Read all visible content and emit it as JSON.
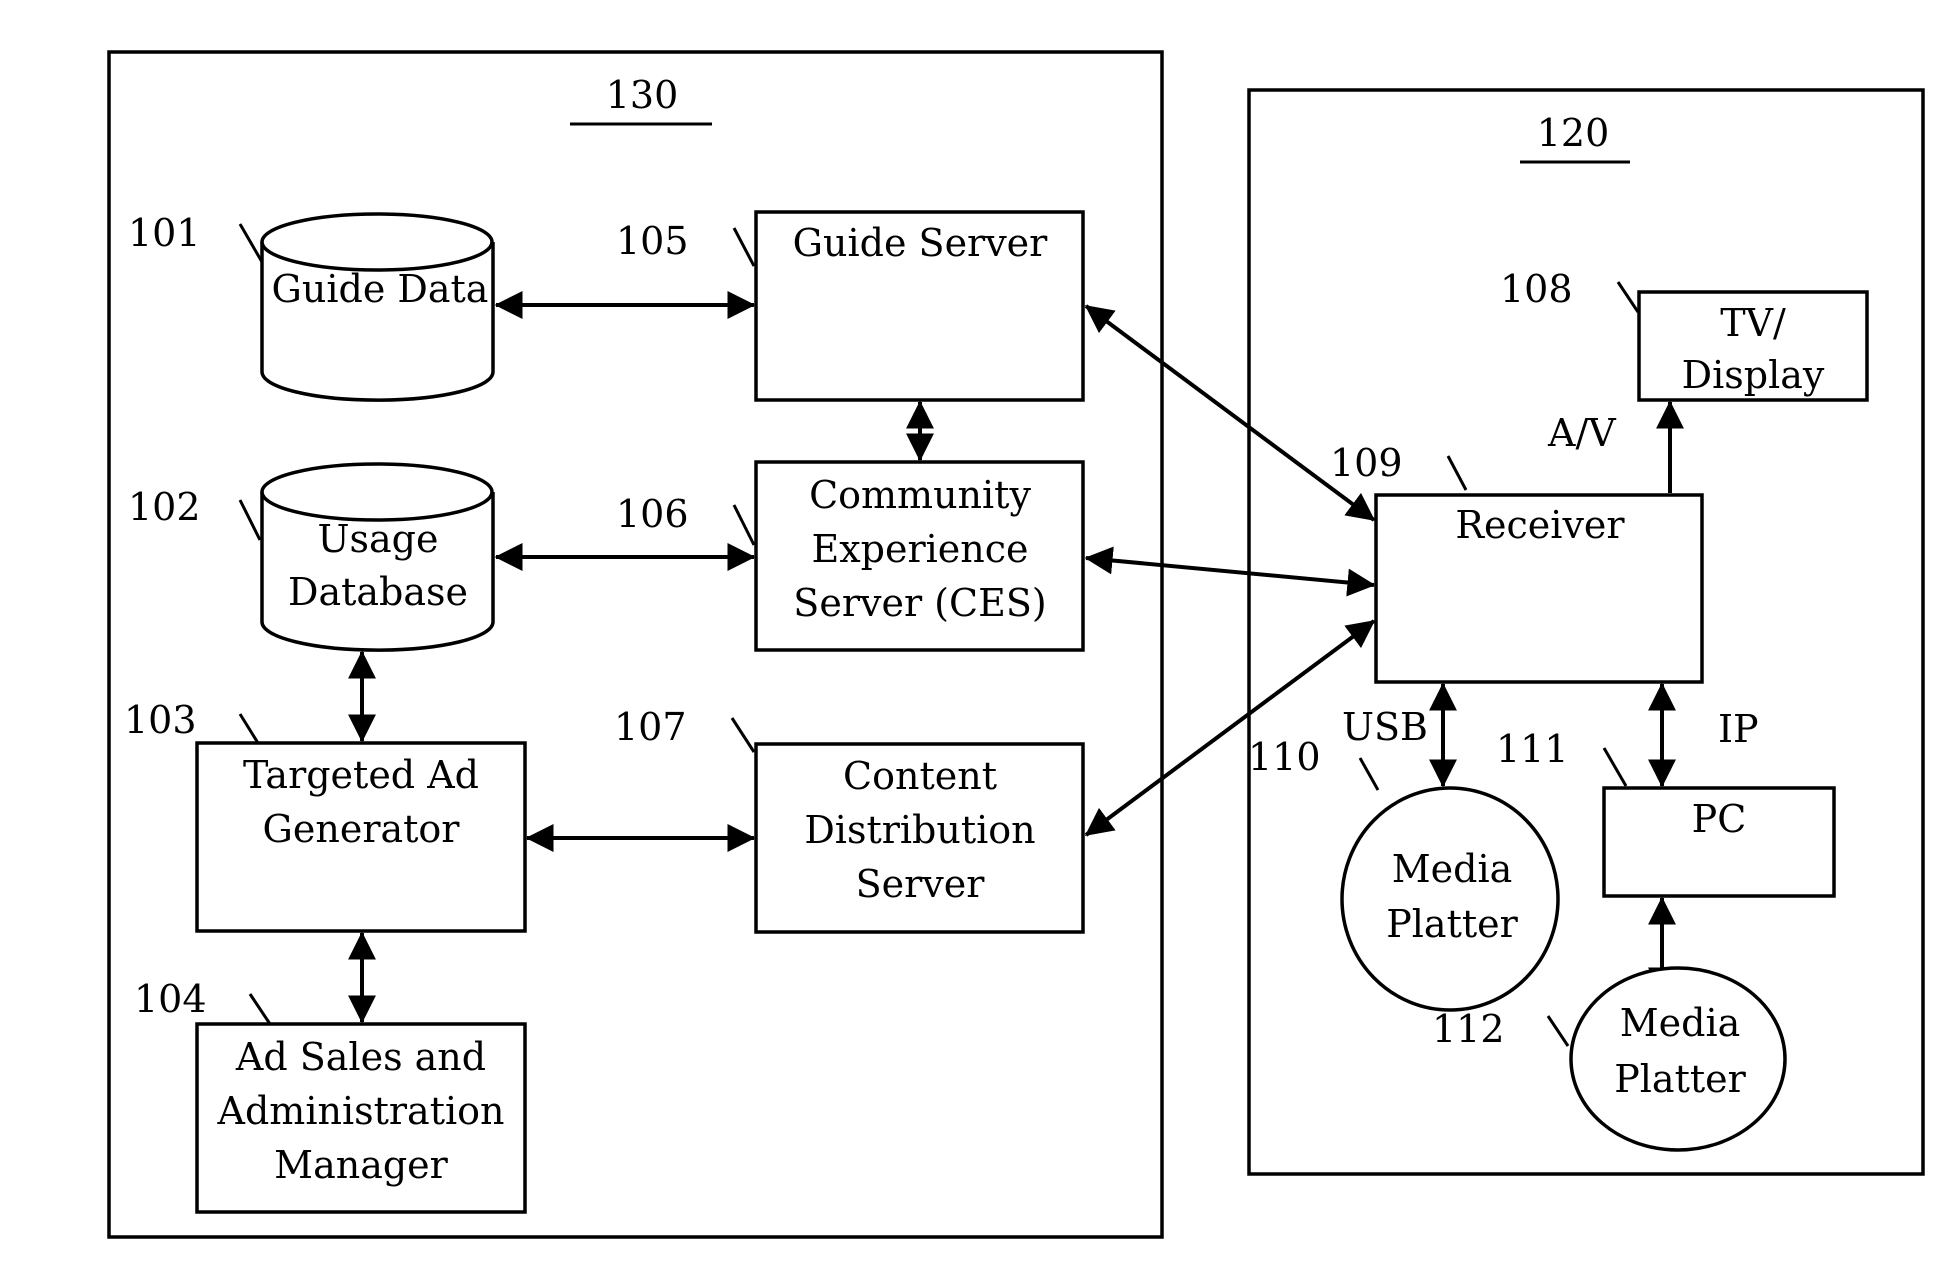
{
  "figure": {
    "groups": [
      {
        "id": "130",
        "ref": "130"
      },
      {
        "id": "120",
        "ref": "120"
      }
    ],
    "nodes": [
      {
        "id": "101",
        "ref": "101",
        "shape": "cylinder",
        "lines": [
          "Guide Data"
        ]
      },
      {
        "id": "102",
        "ref": "102",
        "shape": "cylinder",
        "lines": [
          "Usage",
          "Database"
        ]
      },
      {
        "id": "103",
        "ref": "103",
        "shape": "box",
        "lines": [
          "Targeted Ad",
          "Generator"
        ]
      },
      {
        "id": "104",
        "ref": "104",
        "shape": "box",
        "lines": [
          "Ad Sales and",
          "Administration",
          "Manager"
        ]
      },
      {
        "id": "105",
        "ref": "105",
        "shape": "box",
        "lines": [
          "Guide Server"
        ]
      },
      {
        "id": "106",
        "ref": "106",
        "shape": "box",
        "lines": [
          "Community",
          "Experience",
          "Server (CES)"
        ]
      },
      {
        "id": "107",
        "ref": "107",
        "shape": "box",
        "lines": [
          "Content",
          "Distribution",
          "Server"
        ]
      },
      {
        "id": "108",
        "ref": "108",
        "shape": "box",
        "lines": [
          "TV/",
          "Display"
        ]
      },
      {
        "id": "109",
        "ref": "109",
        "shape": "box",
        "lines": [
          "Receiver"
        ]
      },
      {
        "id": "110",
        "ref": "110",
        "shape": "ellipse",
        "lines": [
          "Media",
          "Platter"
        ]
      },
      {
        "id": "111",
        "ref": "111",
        "shape": "box",
        "lines": [
          "PC"
        ]
      },
      {
        "id": "112",
        "ref": "112",
        "shape": "ellipse",
        "lines": [
          "Media",
          "Platter"
        ]
      }
    ],
    "edge_labels": {
      "av": "A/V",
      "usb": "USB",
      "ip": "IP"
    },
    "edges": [
      {
        "from": "101",
        "to": "105",
        "bidirectional": true
      },
      {
        "from": "105",
        "to": "106",
        "bidirectional": true
      },
      {
        "from": "102",
        "to": "106",
        "bidirectional": true
      },
      {
        "from": "102",
        "to": "103",
        "bidirectional": true
      },
      {
        "from": "103",
        "to": "107",
        "bidirectional": true
      },
      {
        "from": "103",
        "to": "104",
        "bidirectional": true
      },
      {
        "from": "105",
        "to": "109",
        "bidirectional": true
      },
      {
        "from": "106",
        "to": "109",
        "bidirectional": true
      },
      {
        "from": "107",
        "to": "109",
        "bidirectional": true
      },
      {
        "from": "109",
        "to": "108",
        "bidirectional": false,
        "label": "A/V"
      },
      {
        "from": "109",
        "to": "110",
        "bidirectional": true,
        "label": "USB"
      },
      {
        "from": "109",
        "to": "111",
        "bidirectional": true,
        "label": "IP"
      },
      {
        "from": "111",
        "to": "112",
        "bidirectional": true
      }
    ]
  }
}
